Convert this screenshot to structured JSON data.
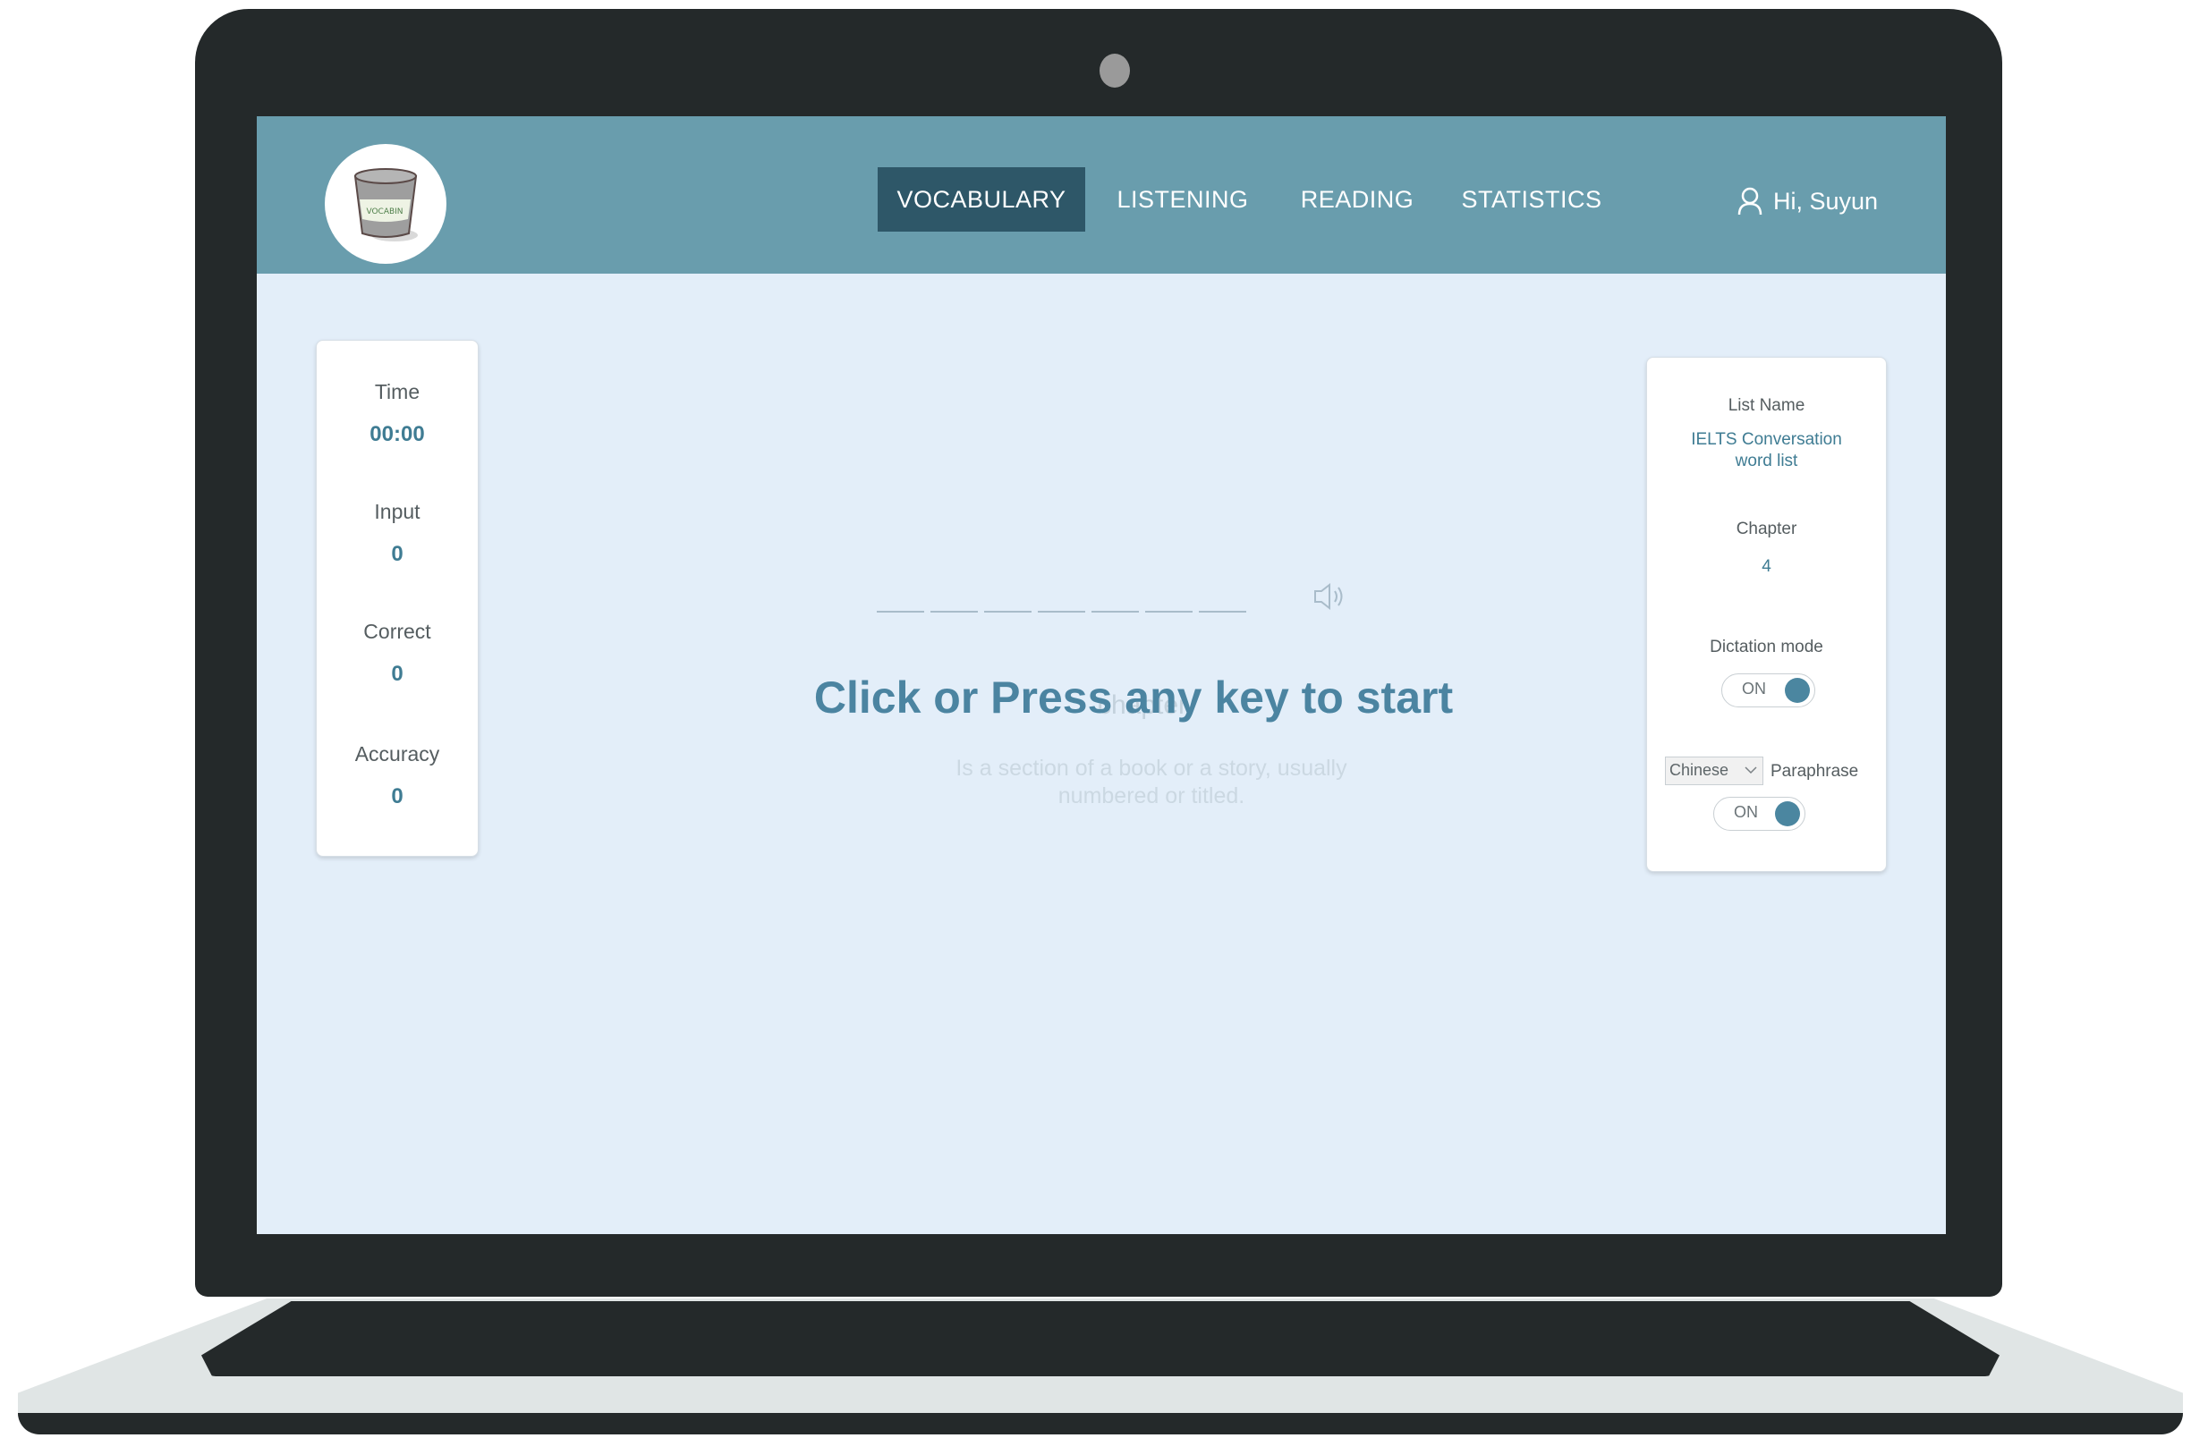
{
  "nav": {
    "tabs": [
      {
        "label": "VOCABULARY",
        "active": true
      },
      {
        "label": "LISTENING",
        "active": false
      },
      {
        "label": "READING",
        "active": false
      },
      {
        "label": "STATISTICS",
        "active": false
      }
    ],
    "greeting": "Hi, Suyun",
    "logo_text": "VOCABIN"
  },
  "stats": {
    "time_label": "Time",
    "time_value": "00:00",
    "input_label": "Input",
    "input_value": "0",
    "correct_label": "Correct",
    "correct_value": "0",
    "accuracy_label": "Accuracy",
    "accuracy_value": "0"
  },
  "main": {
    "start_prompt": "Click or Press any key to start",
    "ghost_word": "chapter",
    "ghost_definition_line1": "Is a section of a book or a story, usually",
    "ghost_definition_line2": "numbered or titled.",
    "blank_count": 7,
    "speaker_icon": "speaker-icon"
  },
  "settings": {
    "list_name_label": "List Name",
    "list_name_line1": "IELTS Conversation",
    "list_name_line2": "word list",
    "chapter_label": "Chapter",
    "chapter_value": "4",
    "dictation_label": "Dictation mode",
    "dictation_state": "ON",
    "language_selected": "Chinese",
    "paraphrase_label": "Paraphrase",
    "paraphrase_state": "ON"
  },
  "colors": {
    "navbar": "#699dad",
    "nav_active": "#2e5768",
    "screen_bg": "#e3eef9",
    "accent": "#3f7c93",
    "frame": "#24292a"
  }
}
